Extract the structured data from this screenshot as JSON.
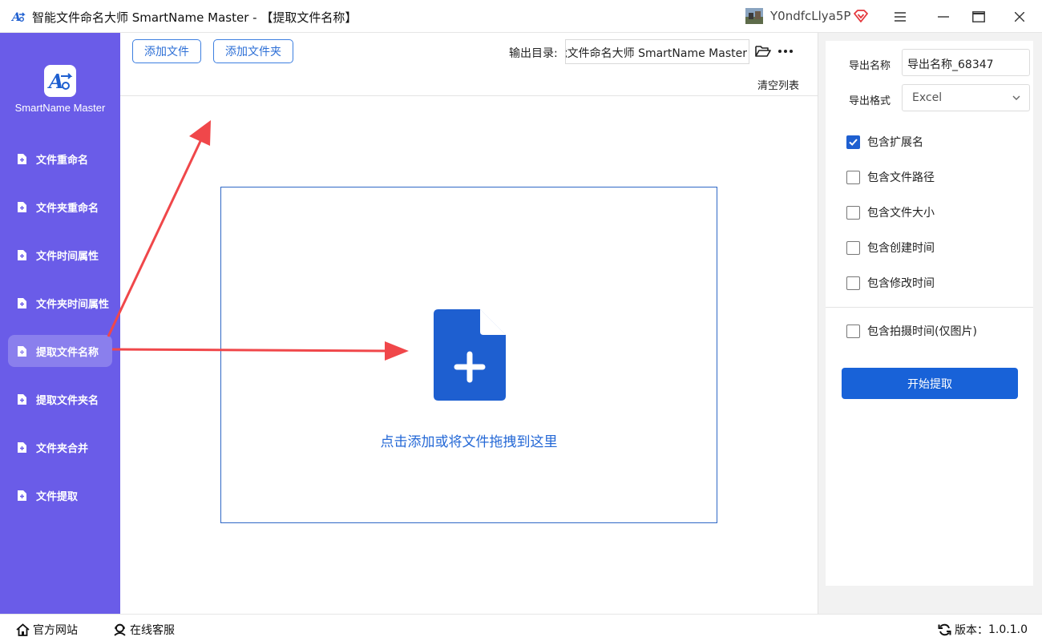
{
  "window": {
    "title": "智能文件命名大师 SmartName Master - 【提取文件名称】",
    "user_name": "Y0ndfcLlya5P"
  },
  "sidebar": {
    "app_name": "SmartName Master",
    "items": [
      {
        "label": "文件重命名"
      },
      {
        "label": "文件夹重命名"
      },
      {
        "label": "文件时间属性"
      },
      {
        "label": "文件夹时间属性"
      },
      {
        "label": "提取文件名称",
        "active": true
      },
      {
        "label": "提取文件夹名"
      },
      {
        "label": "文件夹合并"
      },
      {
        "label": "文件提取"
      }
    ]
  },
  "toolbar": {
    "add_file": "添加文件",
    "add_folder": "添加文件夹",
    "output_label": "输出目录:",
    "output_path": "智能文件命名大师 SmartName Master",
    "clear_list": "清空列表"
  },
  "dropzone": {
    "text": "点击添加或将文件拖拽到这里"
  },
  "export_panel": {
    "name_label": "导出名称",
    "name_value": "导出名称_68347",
    "format_label": "导出格式",
    "format_value": "Excel",
    "options": [
      {
        "label": "包含扩展名",
        "checked": true
      },
      {
        "label": "包含文件路径",
        "checked": false
      },
      {
        "label": "包含文件大小",
        "checked": false
      },
      {
        "label": "包含创建时间",
        "checked": false
      },
      {
        "label": "包含修改时间",
        "checked": false
      },
      {
        "label": "包含拍摄时间(仅图片)",
        "checked": false
      }
    ],
    "start_button": "开始提取"
  },
  "statusbar": {
    "website": "官方网站",
    "support": "在线客服",
    "version_label": "版本：",
    "version": "1.0.1.0"
  },
  "colors": {
    "sidebar": "#6a5ce8",
    "primary": "#1862d8",
    "annotation": "#f0474a"
  },
  "icons": [
    "app-logo-icon",
    "avatar",
    "vip-icon",
    "menu-icon",
    "maximize-icon",
    "close-icon",
    "document-icon",
    "folder-open-icon",
    "more-icon",
    "file-add-icon",
    "chevron-down-icon",
    "checkmark-icon",
    "home-icon",
    "support-icon",
    "refresh-icon"
  ]
}
